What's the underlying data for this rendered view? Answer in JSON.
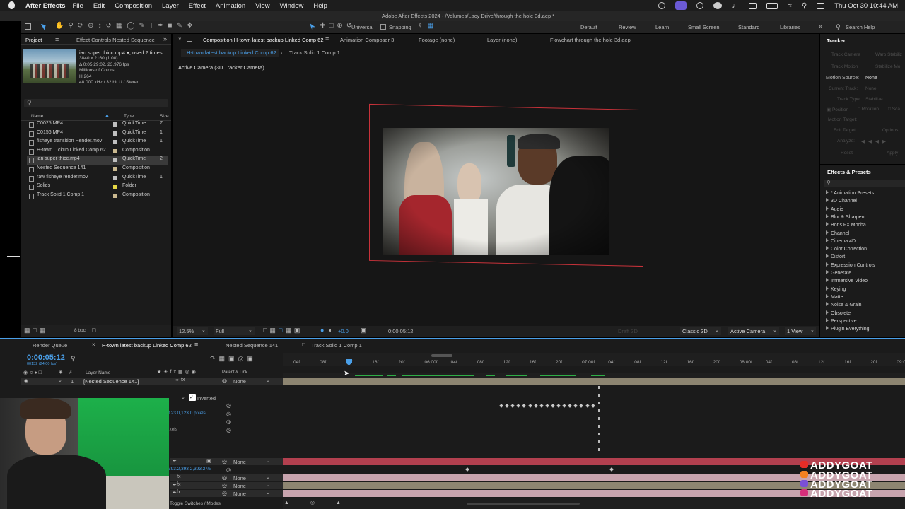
{
  "menubar": {
    "app": "After Effects",
    "items": [
      "File",
      "Edit",
      "Composition",
      "Layer",
      "Effect",
      "Animation",
      "View",
      "Window",
      "Help"
    ],
    "datetime": "Thu Oct 30  10:44 AM"
  },
  "window_title": "Adobe After Effects 2024 - /Volumes/Lacy Drive/through the hole 3d.aep *",
  "toolbar": {
    "universal": "Universal",
    "snapping": "Snapping",
    "workspaces": [
      "Default",
      "Review",
      "Learn",
      "Small Screen",
      "Standard",
      "Libraries"
    ],
    "search_help": "Search Help"
  },
  "project": {
    "tab_project": "Project",
    "tab_effect_controls": "Effect Controls Nested Sequence",
    "info_name": "ian super thicc.mp4 ▾, used 2 times",
    "info_lines": [
      "3840 x 2160 (1.00)",
      "Δ 0:05:29:02, 23.976 fps",
      "Millions of Colors",
      "H.264",
      "48.000 kHz / 32 bit U / Stereo"
    ],
    "col_name": "Name",
    "col_type": "Type",
    "col_size": "Size",
    "bpc": "8 bpc",
    "items": [
      {
        "name": "C0025.MP4",
        "type": "QuickTime",
        "size": "7",
        "color": "#bfbfbf"
      },
      {
        "name": "C0156.MP4",
        "type": "QuickTime",
        "size": "1",
        "color": "#bfbfbf"
      },
      {
        "name": "fisheye transition Render.mov",
        "type": "QuickTime",
        "size": "1",
        "color": "#bfbfbf"
      },
      {
        "name": "H-town ...ckup Linked Comp 62",
        "type": "Composition",
        "size": "",
        "color": "#c9b88f"
      },
      {
        "name": "ian super thicc.mp4",
        "type": "QuickTime",
        "size": "2",
        "color": "#bfbfbf"
      },
      {
        "name": "Nested Sequence 141",
        "type": "Composition",
        "size": "",
        "color": "#c9b88f"
      },
      {
        "name": "raw fisheye render.mov",
        "type": "QuickTime",
        "size": "1",
        "color": "#bfbfbf"
      },
      {
        "name": "Solids",
        "type": "Folder",
        "size": "",
        "color": "#e6d845"
      },
      {
        "name": "Track Solid 1 Comp 1",
        "type": "Composition",
        "size": "",
        "color": "#c9b88f"
      }
    ]
  },
  "comp": {
    "tab": "Composition H-town latest backup Linked Comp 62",
    "tabs_other": [
      "Animation Composer 3",
      "Footage (none)",
      "Layer (none)",
      "Flowchart through the hole 3d.aep"
    ],
    "breadcrumb": [
      "H-town latest backup Linked Comp 62",
      "Track Solid 1 Comp 1"
    ],
    "camera_label": "Active Camera (3D Tracker Camera)",
    "zoom": "12.5%",
    "resolution": "Full",
    "exposure": "+0.0",
    "timecode": "0:00:05:12",
    "renderer": "Classic 3D",
    "camera": "Active Camera",
    "views": "1 View",
    "draft3d": "Draft 3D"
  },
  "tracker": {
    "title": "Tracker",
    "track_camera": "Track Camera",
    "warp_stabilizer": "Warp Stabiliz",
    "track_motion": "Track Motion",
    "stabilize_motion": "Stabilize Mo",
    "motion_source_label": "Motion Source:",
    "motion_source": "None",
    "current_track": "Current Track:",
    "current_track_val": "None",
    "track_type": "Track Type:",
    "track_type_val": "Stabilize",
    "position": "Position",
    "rotation": "Rotation",
    "scale": "Sca",
    "motion_target": "Motion Target:",
    "edit_target": "Edit Target...",
    "options": "Options...",
    "analyze": "Analyze:",
    "reset": "Reset",
    "apply": "Apply"
  },
  "effects": {
    "title": "Effects & Presets",
    "items": [
      "* Animation Presets",
      "3D Channel",
      "Audio",
      "Blur & Sharpen",
      "Boris FX Mocha",
      "Channel",
      "Cinema 4D",
      "Color Correction",
      "Distort",
      "Expression Controls",
      "Generate",
      "Immersive Video",
      "Keying",
      "Matte",
      "Noise & Grain",
      "Obsolete",
      "Perspective",
      "Plugin Everything"
    ]
  },
  "timeline": {
    "tab_render": "Render Queue",
    "tab_main": "H-town latest backup Linked Comp 62",
    "tab_nested": "Nested Sequence 141",
    "tab_track": "Track Solid 1 Comp 1",
    "timecode": "0:00:05:12",
    "timecode_sub": "00132 (24.00 fps)",
    "col_layer_name": "Layer Name",
    "col_parent": "Parent & Link",
    "layer1_num": "1",
    "layer1_name": "[Nested Sequence 141]",
    "none": "None",
    "inverted": "Inverted",
    "value1": "123.0,123.0 pixels",
    "value2": "393.2,393.2,393.2 %",
    "pixels": "ixels",
    "toggle": "Toggle Switches / Modes",
    "ruler": [
      "04f",
      "08f",
      "12f",
      "16f",
      "20f",
      "06:00f",
      "04f",
      "08f",
      "12f",
      "16f",
      "20f",
      "07:00f",
      "04f",
      "08f",
      "12f",
      "16f",
      "20f",
      "08:00f",
      "04f",
      "08f",
      "12f",
      "16f",
      "20f",
      "09:0"
    ]
  },
  "watermark": {
    "text": "ADDYGOAT",
    "icon_colors": [
      "#e52d27",
      "#f48120",
      "#7b4fd6",
      "#d62e7a"
    ]
  },
  "colors": {
    "accent_blue": "#4a9fe8",
    "red_track": "#b3404f",
    "pink_track": "#c8a4ae",
    "tan_track": "#8d8571",
    "green_bar": "#2fae46"
  }
}
